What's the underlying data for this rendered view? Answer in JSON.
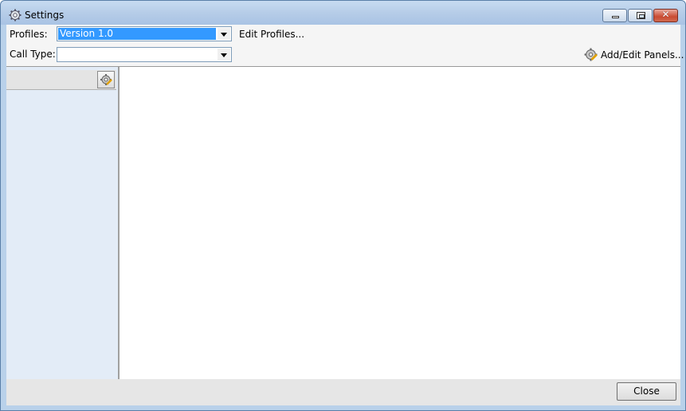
{
  "window": {
    "title": "Settings",
    "icon": "gear-icon"
  },
  "toolbar": {
    "profiles_label": "Profiles:",
    "profiles_value": "Version 1.0",
    "edit_profiles_label": "Edit Profiles...",
    "call_type_label": "Call Type:",
    "call_type_value": "",
    "add_edit_panels_label": "Add/Edit Panels..."
  },
  "footer": {
    "close_label": "Close"
  },
  "colors": {
    "selection": "#3399ff",
    "left_panel": "#e3ecf7",
    "titlebar": "#b9d1ea"
  }
}
